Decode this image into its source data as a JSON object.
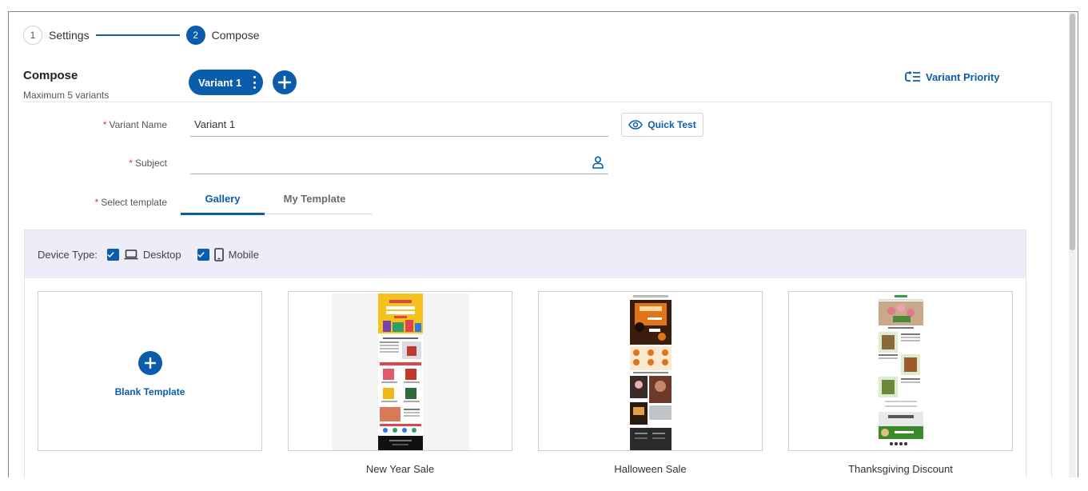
{
  "stepper": {
    "steps": [
      {
        "number": "1",
        "label": "Settings"
      },
      {
        "number": "2",
        "label": "Compose"
      }
    ]
  },
  "compose": {
    "title": "Compose",
    "subtitle": "Maximum 5 variants",
    "variant_tab": "Variant 1",
    "priority_label": "Variant Priority"
  },
  "form": {
    "variant_name_label": "Variant Name",
    "variant_name_value": "Variant 1",
    "subject_label": "Subject",
    "subject_value": "",
    "select_template_label": "Select template",
    "quick_test_label": "Quick Test",
    "required_mark": "*"
  },
  "tabs": [
    {
      "label": "Gallery",
      "active": true
    },
    {
      "label": "My Template",
      "active": false
    }
  ],
  "device": {
    "label": "Device Type:",
    "options": [
      {
        "label": "Desktop",
        "checked": true
      },
      {
        "label": "Mobile",
        "checked": true
      }
    ]
  },
  "templates": [
    {
      "title": "",
      "blank_label": "Blank Template"
    },
    {
      "title": "New Year Sale"
    },
    {
      "title": "Halloween Sale"
    },
    {
      "title": "Thanksgiving Discount"
    }
  ],
  "colors": {
    "primary": "#0b5cab",
    "required": "#d9362b",
    "device_bar": "#ecedf6"
  }
}
